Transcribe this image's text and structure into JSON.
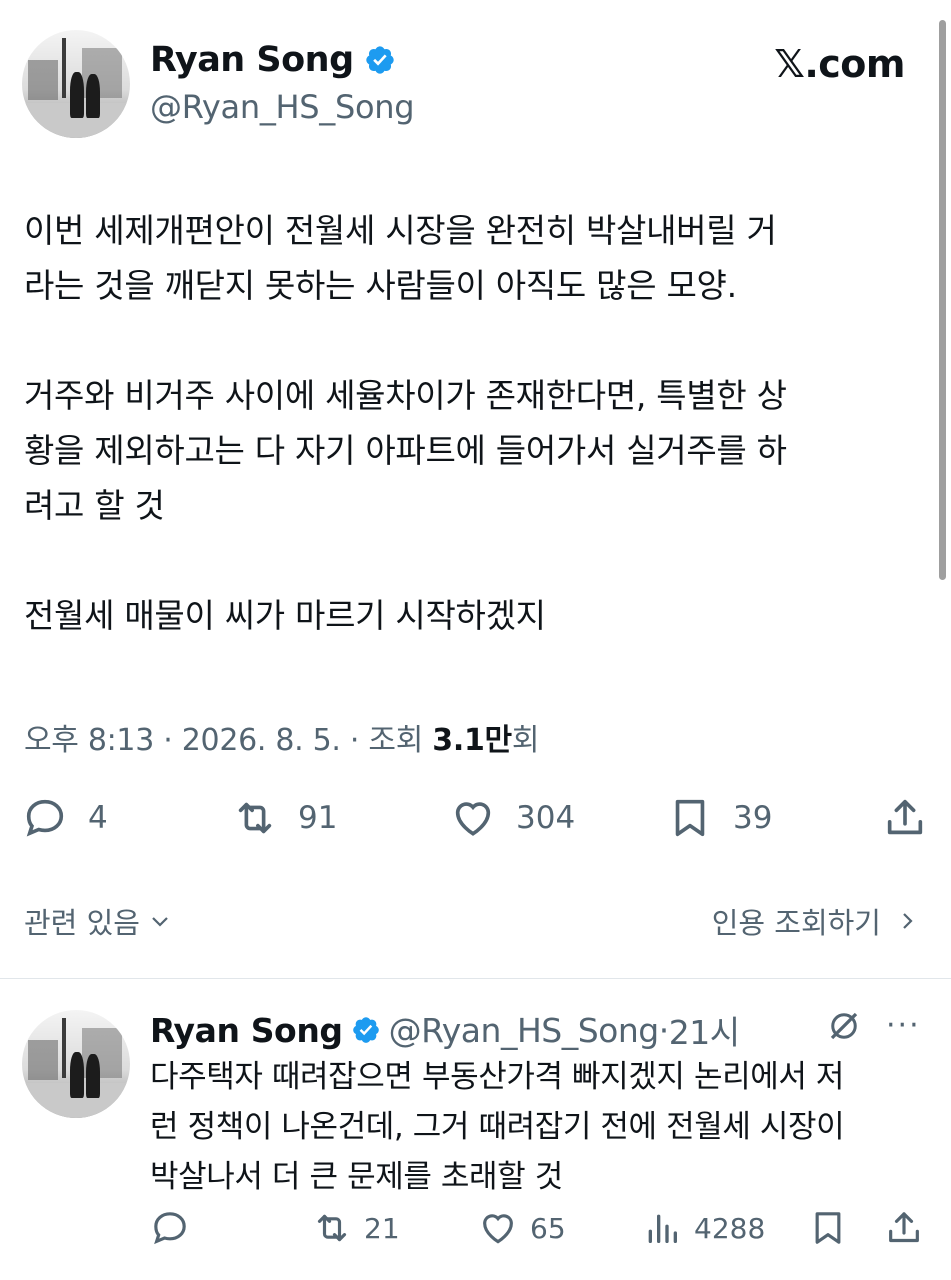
{
  "brand": {
    "domain": "𝕏.com"
  },
  "colors": {
    "verified": "#1d9bf0",
    "text": "#0f1419",
    "muted": "#536471"
  },
  "tweet": {
    "author": {
      "name": "Ryan Song",
      "handle": "@Ryan_HS_Song",
      "verified": true
    },
    "paragraphs": [
      [
        "이번 세제개편안이 전월세 시장을 완전히 박살내버릴 거",
        "라는 것을 깨닫지 못하는 사람들이 아직도 많은 모양."
      ],
      [
        "거주와 비거주 사이에 세율차이가 존재한다면, 특별한 상",
        "황을 제외하고는 다 자기 아파트에 들어가서 실거주를 하",
        "려고 할 것"
      ],
      [
        "전월세 매물이 씨가 마르기 시작하겠지"
      ]
    ],
    "time": "오후 8:13",
    "date": "2026. 8. 5.",
    "views_label": "조회",
    "views": "3.1만",
    "views_suffix": "회",
    "sep": "·",
    "replies": "4",
    "retweets": "91",
    "likes": "304",
    "bookmarks": "39",
    "related_label": "관련 있음",
    "quotes_label": "인용 조회하기"
  },
  "reply": {
    "author": {
      "name": "Ryan Song",
      "handle": "@Ryan_HS_Song",
      "verified": true
    },
    "sep": "·",
    "time": "21시",
    "lines": [
      "다주택자 때려잡으면 부동산가격 빠지겠지 논리에서 저",
      "런 정책이 나온건데, 그거 때려잡기 전에 전월세 시장이",
      "박살나서 더 큰 문제를 초래할 것"
    ],
    "replies": "",
    "retweets": "21",
    "likes": "65",
    "views": "4288",
    "more_label": "···"
  }
}
